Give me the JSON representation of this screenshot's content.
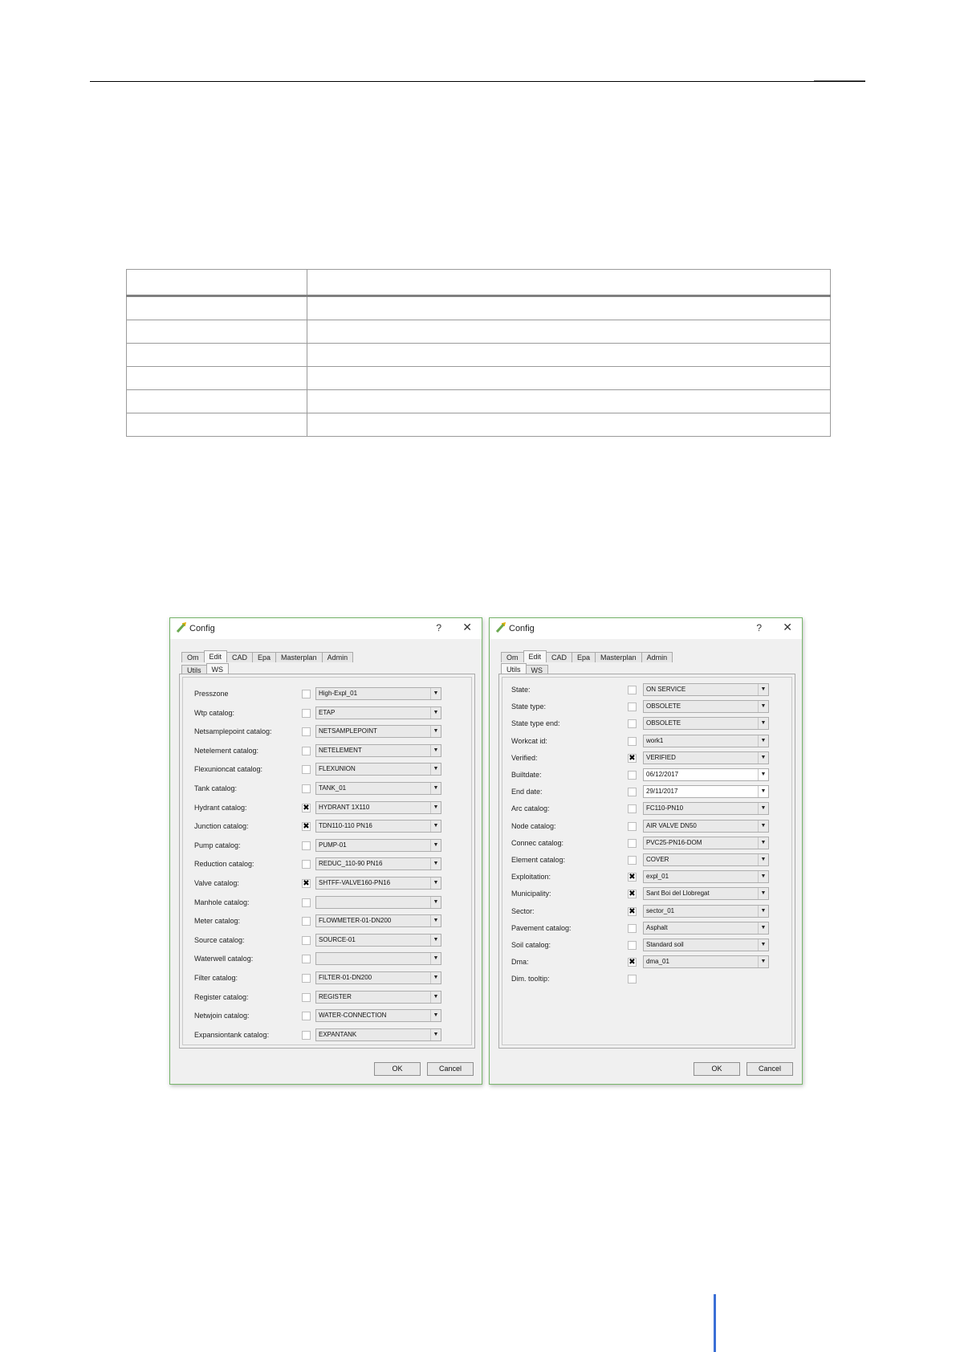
{
  "left_dialog": {
    "title": "Config",
    "help": "?",
    "close": "✕",
    "tabs": [
      "Om",
      "Edit",
      "CAD",
      "Epa",
      "Masterplan",
      "Admin"
    ],
    "subtabs": [
      "Utils",
      "WS"
    ],
    "rows": [
      {
        "label": "Presszone",
        "checked": false,
        "value": "High-Expl_01"
      },
      {
        "label": "Wtp catalog:",
        "checked": false,
        "value": "ETAP"
      },
      {
        "label": "Netsamplepoint catalog:",
        "checked": false,
        "value": "NETSAMPLEPOINT"
      },
      {
        "label": "Netelement catalog:",
        "checked": false,
        "value": "NETELEMENT"
      },
      {
        "label": "Flexunioncat catalog:",
        "checked": false,
        "value": "FLEXUNION"
      },
      {
        "label": "Tank catalog:",
        "checked": false,
        "value": "TANK_01"
      },
      {
        "label": "Hydrant catalog:",
        "checked": true,
        "value": "HYDRANT 1X110"
      },
      {
        "label": "Junction catalog:",
        "checked": true,
        "value": "TDN110-110 PN16"
      },
      {
        "label": "Pump catalog:",
        "checked": false,
        "value": "PUMP-01"
      },
      {
        "label": "Reduction catalog:",
        "checked": false,
        "value": "REDUC_110-90 PN16"
      },
      {
        "label": "Valve catalog:",
        "checked": true,
        "value": "SHTFF-VALVE160-PN16"
      },
      {
        "label": "Manhole catalog:",
        "checked": false,
        "value": ""
      },
      {
        "label": "Meter catalog:",
        "checked": false,
        "value": "FLOWMETER-01-DN200"
      },
      {
        "label": "Source catalog:",
        "checked": false,
        "value": "SOURCE-01"
      },
      {
        "label": "Waterwell catalog:",
        "checked": false,
        "value": ""
      },
      {
        "label": "Filter catalog:",
        "checked": false,
        "value": "FILTER-01-DN200"
      },
      {
        "label": "Register catalog:",
        "checked": false,
        "value": "REGISTER"
      },
      {
        "label": "Netwjoin catalog:",
        "checked": false,
        "value": "WATER-CONNECTION"
      },
      {
        "label": "Expansiontank catalog:",
        "checked": false,
        "value": "EXPANTANK"
      }
    ],
    "ok_label": "OK",
    "cancel_label": "Cancel"
  },
  "right_dialog": {
    "title": "Config",
    "help": "?",
    "close": "✕",
    "tabs": [
      "Om",
      "Edit",
      "CAD",
      "Epa",
      "Masterplan",
      "Admin"
    ],
    "subtabs": [
      "Utils",
      "WS"
    ],
    "rows": [
      {
        "label": "State:",
        "checked": false,
        "value": "ON SERVICE"
      },
      {
        "label": "State type:",
        "checked": false,
        "value": "OBSOLETE"
      },
      {
        "label": "State type end:",
        "checked": false,
        "value": "OBSOLETE"
      },
      {
        "label": "Workcat id:",
        "checked": false,
        "value": "work1"
      },
      {
        "label": "Verified:",
        "checked": true,
        "value": "VERIFIED"
      },
      {
        "label": "Builtdate:",
        "checked": false,
        "value": "06/12/2017",
        "white": true
      },
      {
        "label": "End date:",
        "checked": false,
        "value": "29/11/2017",
        "white": true
      },
      {
        "label": "Arc catalog:",
        "checked": false,
        "value": "FC110-PN10"
      },
      {
        "label": "Node catalog:",
        "checked": false,
        "value": "AIR VALVE DN50"
      },
      {
        "label": "Connec catalog:",
        "checked": false,
        "value": "PVC25-PN16-DOM"
      },
      {
        "label": "Element catalog:",
        "checked": false,
        "value": "COVER"
      },
      {
        "label": "Exploitation:",
        "checked": true,
        "value": "expl_01"
      },
      {
        "label": "Municipality:",
        "checked": true,
        "value": "Sant Boi del Llobregat"
      },
      {
        "label": "Sector:",
        "checked": true,
        "value": "sector_01"
      },
      {
        "label": "Pavement catalog:",
        "checked": false,
        "value": "Asphalt"
      },
      {
        "label": "Soil catalog:",
        "checked": false,
        "value": "Standard soil"
      },
      {
        "label": "Dma:",
        "checked": true,
        "value": "dma_01"
      },
      {
        "label": "Dim. tooltip:",
        "checked": false,
        "value": null
      }
    ],
    "ok_label": "OK",
    "cancel_label": "Cancel"
  },
  "icons": {
    "check_mark": "✖",
    "dropdown_arrow": "▼"
  }
}
